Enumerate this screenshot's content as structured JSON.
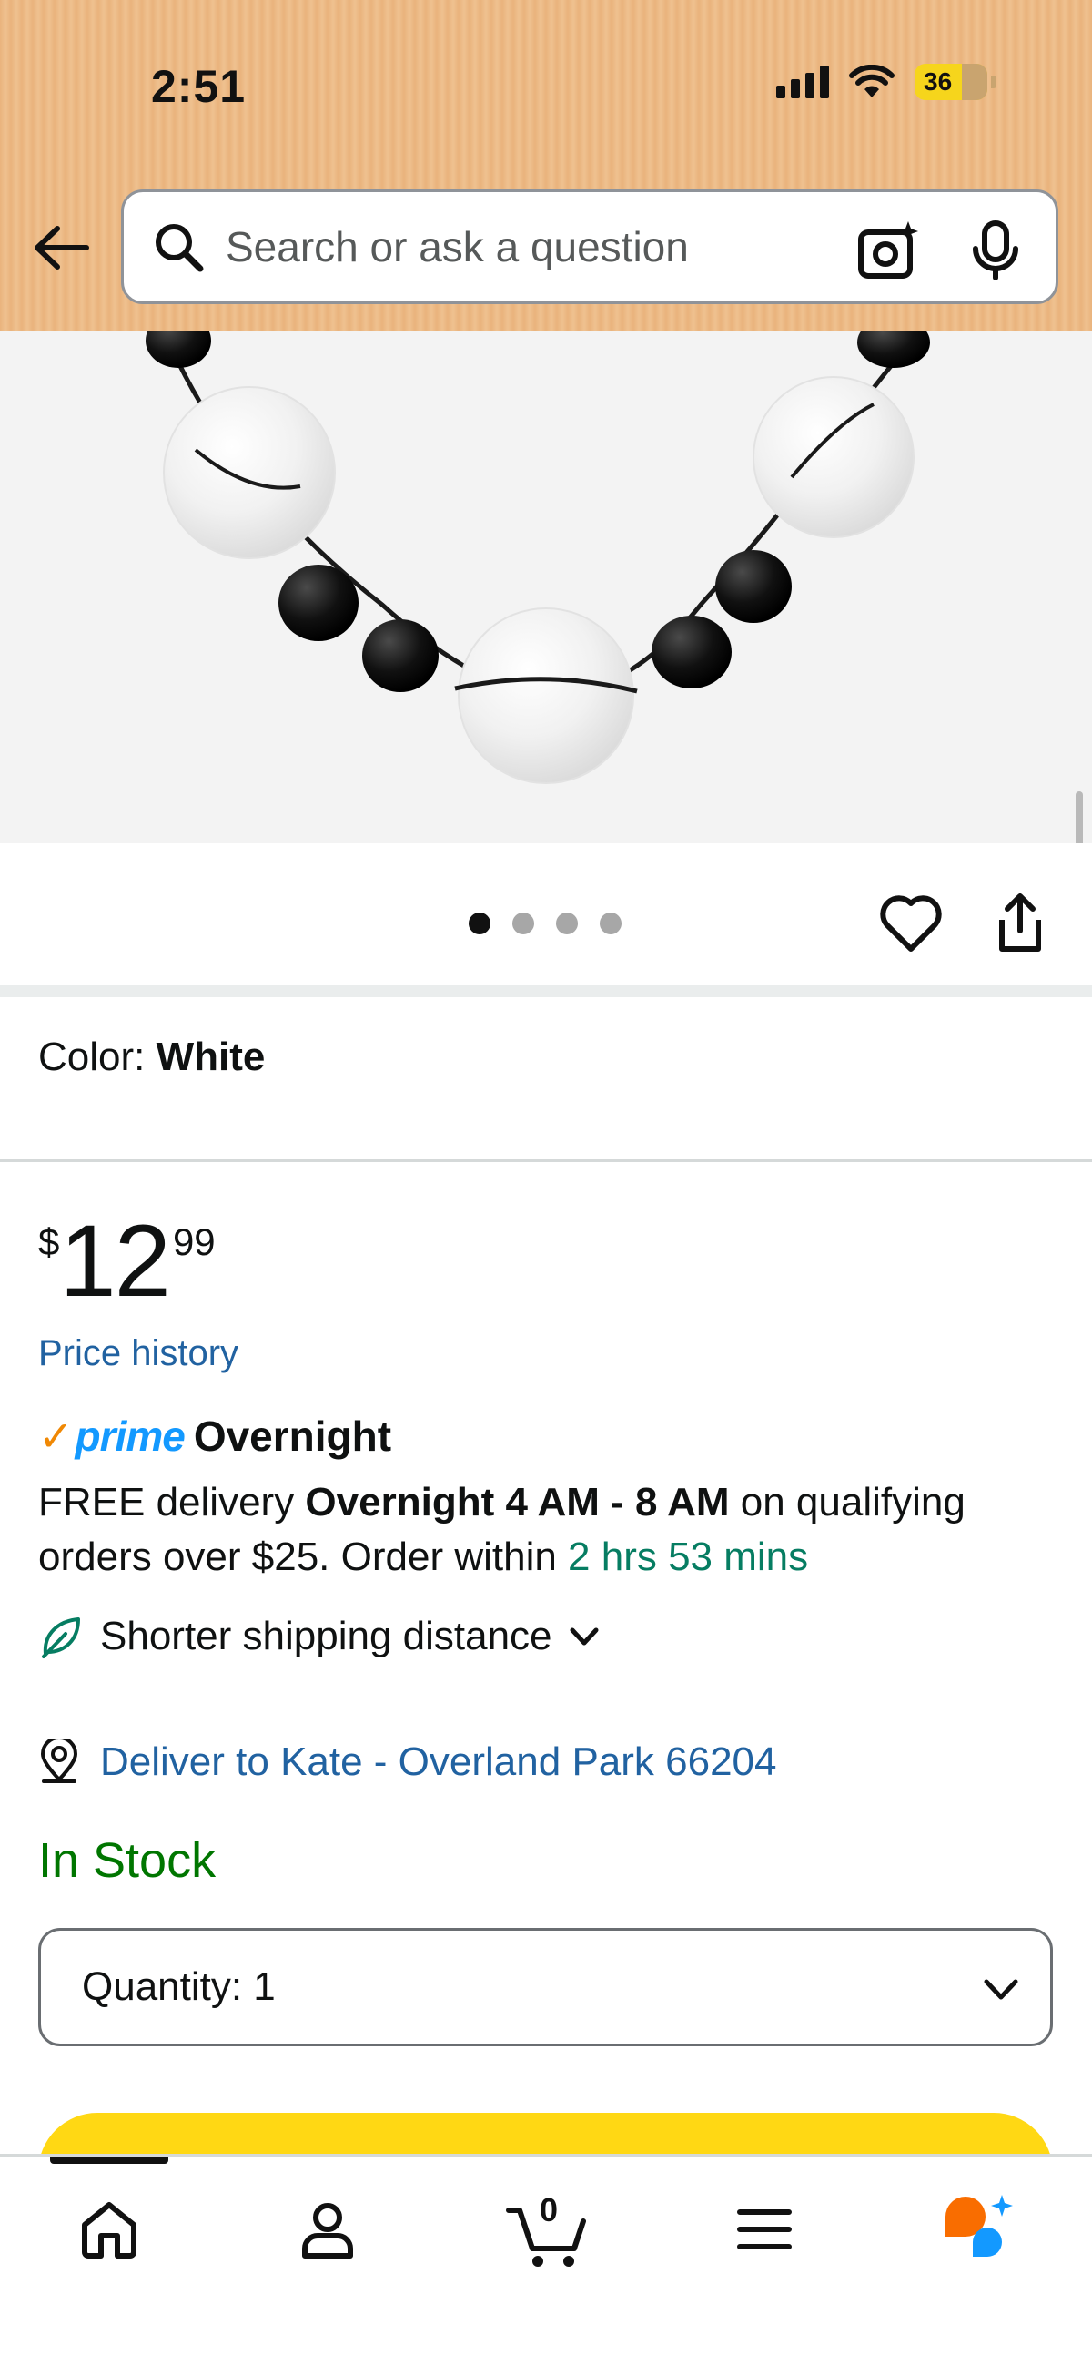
{
  "status_bar": {
    "time": "2:51",
    "battery": "36"
  },
  "search": {
    "placeholder": "Search or ask a question"
  },
  "gallery": {
    "image_count": 4,
    "active_index": 0
  },
  "color": {
    "label": "Color:",
    "value": "White"
  },
  "price": {
    "symbol": "$",
    "whole": "12",
    "fraction": "99",
    "history_link": "Price history"
  },
  "delivery": {
    "prime_check": "✓",
    "prime_word": "prime",
    "prime_label": "Overnight",
    "text_1": "FREE delivery ",
    "text_bold": "Overnight 4 AM - 8 AM",
    "text_2": " on qualifying orders over $25. Order within ",
    "countdown": "2 hrs 53 mins",
    "shipping_label": "Shorter shipping distance",
    "deliver_to": "Deliver to Kate - Overland Park 66204"
  },
  "stock": {
    "status": "In Stock"
  },
  "quantity": {
    "label": "Quantity: 1"
  },
  "nav": {
    "cart_count": "0"
  },
  "colors": {
    "accent_orange": "#f08804",
    "prime_blue": "#1399ff",
    "link_blue": "#2162a1",
    "stock_green": "#007600",
    "countdown_green": "#067d62",
    "cart_yellow": "#ffd814"
  }
}
